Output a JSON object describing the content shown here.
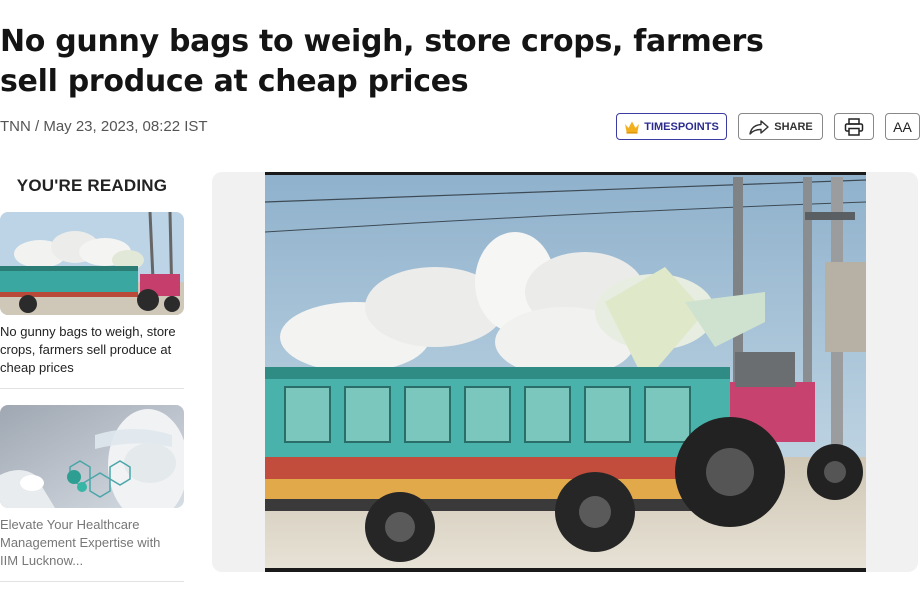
{
  "article": {
    "title": "No gunny bags to weigh, store crops, farmers sell produce at cheap prices",
    "byline": "TNN / May 23, 2023, 08:22 IST"
  },
  "actions": {
    "timespoints_label": "TIMESPOINTS",
    "share_label": "SHARE",
    "font_size_label": "AA"
  },
  "sidebar": {
    "heading": "YOU'RE READING",
    "items": [
      {
        "text": "No gunny bags to weigh, store crops, farmers sell produce at cheap prices"
      },
      {
        "text": "Elevate Your Healthcare Management Expertise with IIM Lucknow..."
      }
    ]
  },
  "icons": {
    "timespoints": "crown-icon",
    "share": "share-arrow-icon",
    "print": "printer-icon"
  },
  "colors": {
    "timespoints_accent": "#2b2b8f",
    "crown": "#f2b01e",
    "media_bg": "#f1f1f1"
  }
}
